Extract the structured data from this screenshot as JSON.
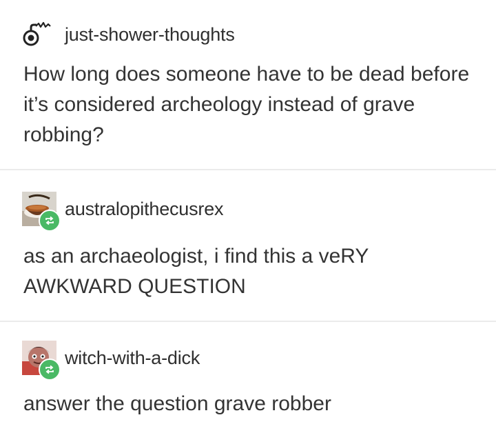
{
  "posts": [
    {
      "username": "just-shower-thoughts",
      "text": "How long does someone have to be dead before it’s considered archeology instead of grave robbing?",
      "avatar_icon": "shower-head-icon",
      "reblog": false
    },
    {
      "username": "australopithecusrex",
      "text": "as an archaeologist, i find this a veRY AWKWARD QUESTION",
      "avatar_icon": "teacup-avatar",
      "reblog": true
    },
    {
      "username": "witch-with-a-dick",
      "text": "answer the question grave robber",
      "avatar_icon": "cartoon-character-avatar",
      "reblog": true
    }
  ],
  "colors": {
    "reblog_badge": "#4ab965",
    "text": "#333333",
    "divider": "#ebebeb"
  }
}
